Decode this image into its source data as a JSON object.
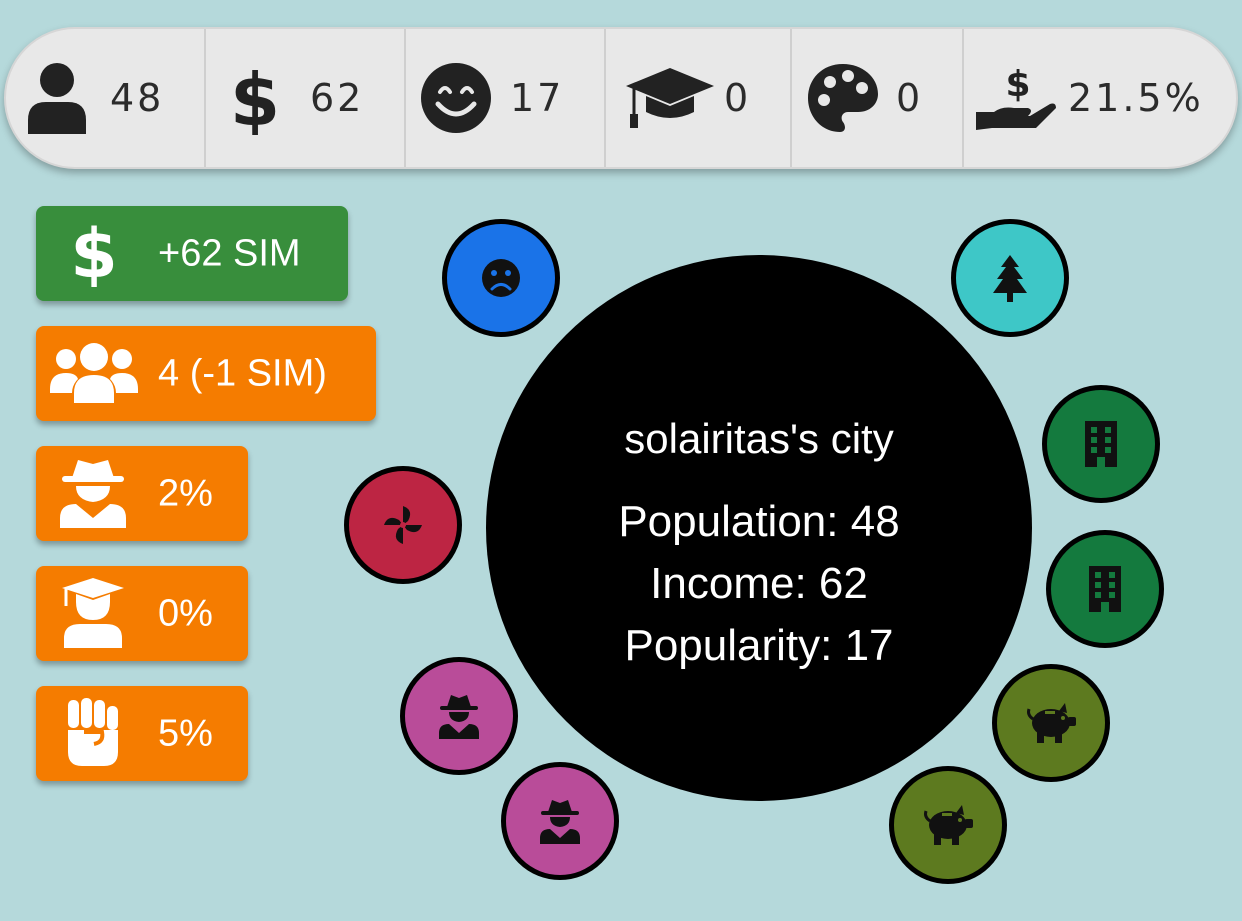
{
  "stats": {
    "population": "48",
    "money": "62",
    "happiness": "17",
    "education": "0",
    "culture": "0",
    "tax_rate": "21.5%"
  },
  "actions": {
    "income": "+62 SIM",
    "people": "4 (-1 SIM)",
    "crime": "2%",
    "education": "0%",
    "protest": "5%"
  },
  "city": {
    "name": "solairitas's city",
    "population": "Population: 48",
    "income": "Income: 62",
    "popularity": "Popularity: 17"
  },
  "buildings": [
    {
      "type": "unhappy-face",
      "color": "#1a73e8"
    },
    {
      "type": "park-tree",
      "color": "#3ec7c7"
    },
    {
      "type": "office-building",
      "color": "#147a3e"
    },
    {
      "type": "office-building",
      "color": "#147a3e"
    },
    {
      "type": "fan-turbine",
      "color": "#bd2543"
    },
    {
      "type": "piggy-bank",
      "color": "#5d7a1f"
    },
    {
      "type": "piggy-bank",
      "color": "#5d7a1f"
    },
    {
      "type": "spy-agency",
      "color": "#b94c99"
    },
    {
      "type": "spy-agency",
      "color": "#b94c99"
    }
  ],
  "colors": {
    "background": "#b5d9db",
    "statsbar": "#e8e8e8",
    "income_button": "#388e3c",
    "action_button": "#f57c00",
    "city": "#000000"
  }
}
